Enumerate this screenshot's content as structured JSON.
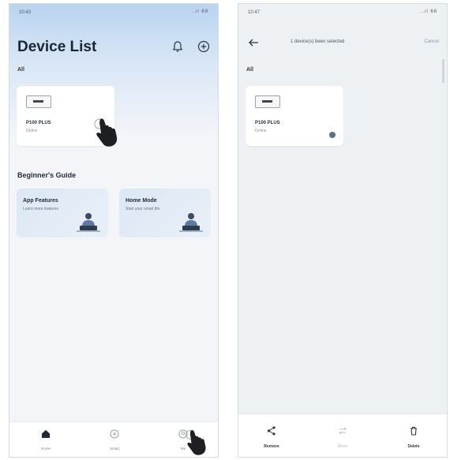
{
  "left_screen": {
    "status_time": "10:43",
    "status_icons": "..ıl 69",
    "title": "Device List",
    "filter_label": "All",
    "device": {
      "name": "P100 PLUS",
      "status": "Online"
    },
    "guide_section_title": "Beginner's Guide",
    "guides": [
      {
        "title": "App Features",
        "subtitle": "Learn more features"
      },
      {
        "title": "Home Mode",
        "subtitle": "Start your smart life"
      }
    ],
    "tabs": [
      {
        "label": "Home"
      },
      {
        "label": "Smart"
      },
      {
        "label": "Me"
      }
    ]
  },
  "right_screen": {
    "status_time": "10:47",
    "status_icons": "..ıl 68",
    "selection_text": "1 device(s) been selected",
    "cancel_label": "Cancel",
    "filter_label": "All",
    "device": {
      "name": "P100 PLUS",
      "status": "Online"
    },
    "actions": [
      {
        "label": "Remove",
        "enabled": true
      },
      {
        "label": "Move",
        "enabled": false
      },
      {
        "label": "Delete",
        "enabled": true
      }
    ]
  },
  "colors": {
    "header_gradient_top": "#b9d3f0",
    "accent_dark": "#1c2533",
    "selected_radio": "#5b6f86"
  },
  "icons": [
    "bell-icon",
    "add-circle-icon",
    "home-icon",
    "smart-icon",
    "me-icon",
    "back-arrow-icon",
    "share-icon",
    "move-icon",
    "trash-icon",
    "pointing-hand-icon"
  ]
}
